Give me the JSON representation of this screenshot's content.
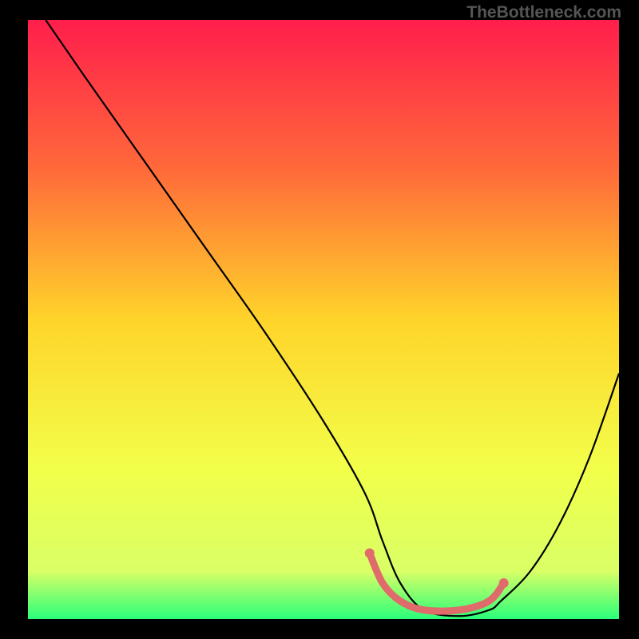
{
  "watermark": "TheBottleneck.com",
  "chart_data": {
    "type": "line",
    "title": "",
    "xlabel": "",
    "ylabel": "",
    "xlim": [
      0,
      100
    ],
    "ylim": [
      0,
      100
    ],
    "background_gradient": {
      "type": "vertical",
      "stops": [
        {
          "offset": 0,
          "color": "#ff1e4c"
        },
        {
          "offset": 0.25,
          "color": "#ff6a3a"
        },
        {
          "offset": 0.5,
          "color": "#ffd42a"
        },
        {
          "offset": 0.75,
          "color": "#f2ff4a"
        },
        {
          "offset": 0.92,
          "color": "#d9ff66"
        },
        {
          "offset": 1.0,
          "color": "#2aff7a"
        }
      ]
    },
    "series": [
      {
        "name": "bottleneck-curve",
        "color": "#000000",
        "x": [
          3,
          10,
          20,
          30,
          40,
          50,
          57,
          60,
          63,
          67,
          73,
          78,
          80,
          85,
          90,
          95,
          100
        ],
        "y": [
          100,
          90,
          76,
          62,
          48,
          33,
          21,
          13,
          6,
          1.5,
          0.5,
          1.5,
          3,
          8,
          16,
          27,
          41
        ]
      }
    ],
    "highlight_segment": {
      "name": "optimal-range",
      "color": "#e06b6b",
      "x": [
        57.8,
        60,
        63,
        67,
        73,
        78,
        80.5
      ],
      "y": [
        11,
        6,
        3,
        1.5,
        1.5,
        3,
        6
      ]
    },
    "highlight_endpoints": [
      {
        "x": 57.8,
        "y": 11
      },
      {
        "x": 80.5,
        "y": 6
      }
    ]
  }
}
